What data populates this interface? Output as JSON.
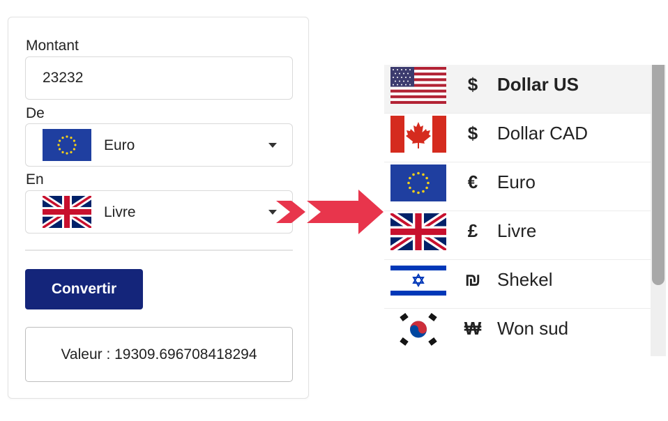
{
  "converter": {
    "amount_label": "Montant",
    "amount_value": "23232",
    "from_label": "De",
    "from_currency": "Euro",
    "from_flag": "eu-flag-icon",
    "to_label": "En",
    "to_currency": "Livre",
    "to_flag": "uk-flag-icon",
    "convert_button": "Convertir",
    "result_text": "Valeur : 19309.696708418294"
  },
  "currency_list": [
    {
      "flag": "us-flag-icon",
      "symbol": "$",
      "name": "Dollar US",
      "highlighted": true
    },
    {
      "flag": "canada-flag-icon",
      "symbol": "$",
      "name": "Dollar CAD"
    },
    {
      "flag": "eu-flag-icon",
      "symbol": "€",
      "name": "Euro"
    },
    {
      "flag": "uk-flag-icon",
      "symbol": "£",
      "name": "Livre"
    },
    {
      "flag": "israel-flag-icon",
      "symbol": "₪",
      "name": "Shekel"
    },
    {
      "flag": "south-korea-flag-icon",
      "symbol": "₩",
      "name": "Won sud"
    }
  ],
  "colors": {
    "button": "#14257a",
    "arrow": "#e8354c",
    "highlight_row": "#f3f3f3"
  }
}
